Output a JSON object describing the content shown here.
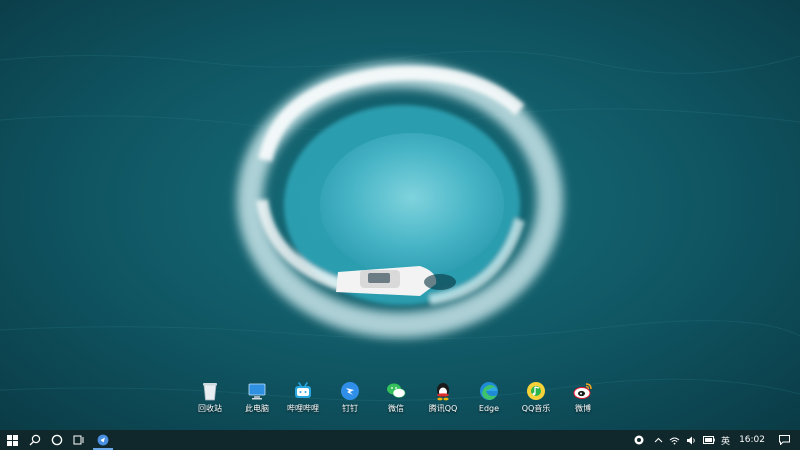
{
  "desktop": {
    "icons": [
      {
        "label": "回收站",
        "icon": "recycle-bin-icon"
      },
      {
        "label": "此电脑",
        "icon": "computer-icon"
      },
      {
        "label": "哔哩哔哩",
        "icon": "bilibili-icon"
      },
      {
        "label": "钉钉",
        "icon": "dingtalk-icon"
      },
      {
        "label": "微信",
        "icon": "wechat-icon"
      },
      {
        "label": "腾讯QQ",
        "icon": "qq-icon"
      },
      {
        "label": "Edge",
        "icon": "edge-icon"
      },
      {
        "label": "QQ音乐",
        "icon": "qq-music-icon"
      },
      {
        "label": "微博",
        "icon": "weibo-icon"
      }
    ]
  },
  "taskbar": {
    "start_icon": "windows-start-icon",
    "search_icon": "search-icon",
    "cortana_icon": "cortana-icon",
    "task_view_icon": "task-view-icon",
    "pinned_app_icon": "app-icon"
  },
  "tray": {
    "ime_label": "英",
    "clock": "16:02"
  },
  "colors": {
    "taskbar_bg": "#10282c",
    "sea_dark": "#0d4a57",
    "lagoon": "#4fb7c9"
  }
}
